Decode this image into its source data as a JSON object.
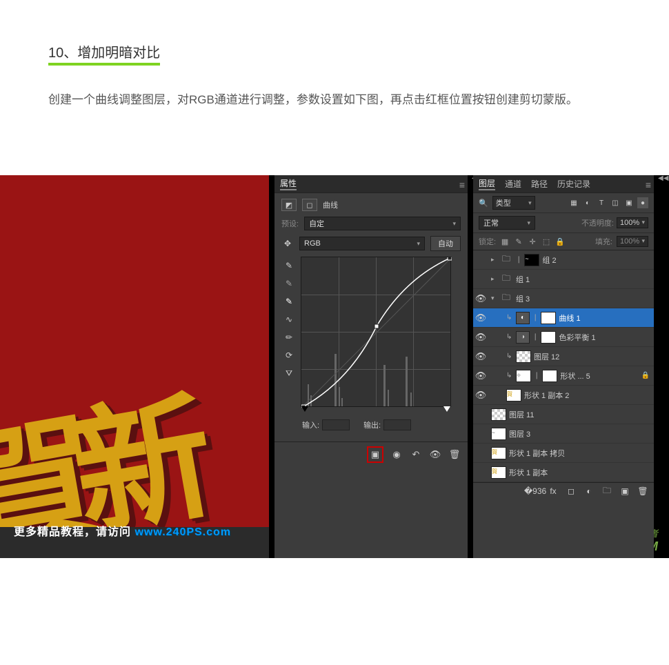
{
  "step": {
    "number": "10、",
    "title": "增加明暗对比",
    "description": "创建一个曲线调整图层，对RGB通道进行调整，参数设置如下图，再点击红框位置按钮创建剪切蒙版。"
  },
  "canvas_text": "賀新",
  "more_tutorials": {
    "prefix": "更多精品教程，请访问 ",
    "link": "www.240PS.com"
  },
  "watermark": "UiBQ.CoM",
  "watermark2": "PS 爱好者",
  "properties": {
    "tab": "属性",
    "adjustment_label": "曲线",
    "preset_label": "预设:",
    "preset_value": "自定",
    "channel_value": "RGB",
    "auto_button": "自动",
    "input_label": "输入:",
    "output_label": "输出:",
    "tools": {
      "eyedropper_black": "black-point-eyedropper",
      "eyedropper_gray": "gray-point-eyedropper",
      "eyedropper_white": "white-point-eyedropper",
      "target_adjust": "target-adjust",
      "curve_tool": "curve-tool",
      "pencil_tool": "pencil-tool",
      "smooth_tool": "smooth-tool",
      "hand_tool": "histogram-options"
    },
    "footer_icons": {
      "clip": "clip-to-layer",
      "prev": "previous-state",
      "reset": "reset",
      "visibility": "toggle-visibility",
      "delete": "delete-adjustment"
    }
  },
  "layers_panel": {
    "tabs": {
      "layers": "图层",
      "channels": "通道",
      "paths": "路径",
      "history": "历史记录"
    },
    "type_dropdown": "类型",
    "blend_mode": "正常",
    "opacity_label": "不透明度:",
    "opacity_value": "100%",
    "lock_label": "锁定:",
    "fill_label": "填充:",
    "fill_value": "100%",
    "layers": [
      {
        "name": "组 2",
        "type": "group_masked",
        "visible": false,
        "expanded": false,
        "indent": 0
      },
      {
        "name": "组 1",
        "type": "group",
        "visible": false,
        "expanded": false,
        "indent": 0
      },
      {
        "name": "组 3",
        "type": "group",
        "visible": true,
        "expanded": true,
        "indent": 0
      },
      {
        "name": "曲线 1",
        "type": "adjustment",
        "visible": true,
        "clipped": true,
        "indent": 1,
        "selected": true,
        "icon": "◐"
      },
      {
        "name": "色彩平衡 1",
        "type": "adjustment",
        "visible": true,
        "clipped": true,
        "indent": 1,
        "icon": "◑"
      },
      {
        "name": "图层 12",
        "type": "raster",
        "visible": true,
        "clipped": true,
        "indent": 1
      },
      {
        "name": "形状 ... 5",
        "type": "shape",
        "visible": true,
        "clipped": true,
        "indent": 1,
        "locked": true,
        "icon": "◆"
      },
      {
        "name": "形状 1 副本 2",
        "type": "shape_gold",
        "visible": true,
        "indent": 1
      },
      {
        "name": "图层 11",
        "type": "raster_trans",
        "visible": false,
        "indent": 0
      },
      {
        "name": "图层 3",
        "type": "raster_small",
        "visible": false,
        "indent": 0
      },
      {
        "name": "形状 1 副本 拷贝",
        "type": "shape_gold",
        "visible": false,
        "indent": 0
      },
      {
        "name": "形状 1 副本",
        "type": "shape_gold_cut",
        "visible": false,
        "indent": 0
      }
    ],
    "footer_icons": {
      "link": "link-layers",
      "fx": "layer-style",
      "mask": "add-mask",
      "adjust": "new-adjustment",
      "group": "new-group",
      "new": "new-layer",
      "trash": "delete-layer"
    }
  }
}
